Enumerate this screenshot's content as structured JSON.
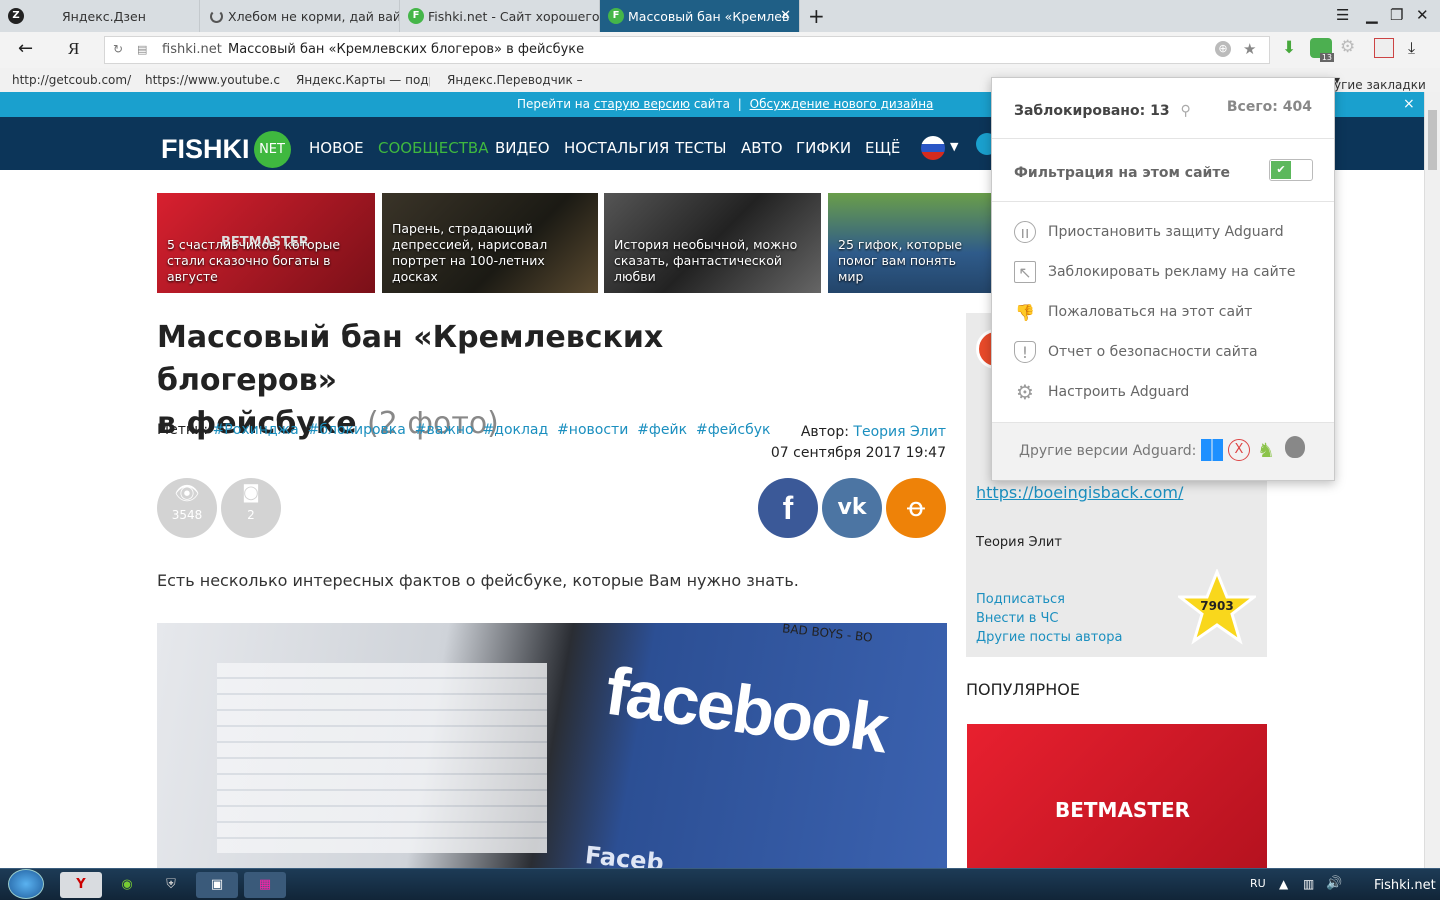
{
  "browser": {
    "tabs": [
      {
        "label": "Яндекс.Дзен",
        "icon": "Z"
      },
      {
        "label": "Хлебом не корми, дай вай",
        "icon": "spinner"
      },
      {
        "label": "Fishki.net - Сайт хорошего",
        "icon": "F"
      },
      {
        "label": "Массовый бан «Кремлев",
        "icon": "F"
      }
    ],
    "address": {
      "domain": "fishki.net",
      "title": "Массовый бан «Кремлевских блогеров» в фейсбуке",
      "yandex": "Я"
    },
    "bookmarks": [
      "http://getcoub.com/",
      "https://www.youtube.c",
      "Яндекс.Карты — подр",
      "Яндекс.Переводчик –",
      "угие закладки"
    ],
    "adguard_badge": "13"
  },
  "page": {
    "notice": {
      "prefix": "Перейти на",
      "link1": "старую версию",
      "middle": "сайта",
      "sep": "|",
      "link2": "Обсуждение нового дизайна",
      "close": "×"
    },
    "logo": {
      "main": "FISHKI",
      "badge": "NET"
    },
    "nav": [
      "НОВОЕ",
      "СООБЩЕСТВА",
      "ВИДЕО",
      "НОСТАЛЬГИЯ",
      "ТЕСТЫ",
      "АВТО",
      "ГИФКИ",
      "ЕЩЁ"
    ],
    "cards": [
      {
        "text": "5 счастливчиков, которые стали сказочно богаты в августе",
        "brand": "BETMASTER"
      },
      {
        "text": "Парень, страдающий депрессией, нарисовал портрет на 100-летних досках"
      },
      {
        "text": "История необычной, можно сказать, фантастической любви"
      },
      {
        "text": "25 гифок, которые помог вам понять мир"
      }
    ],
    "article": {
      "title_line1": "Массовый бан «Кремлевских блогеров»",
      "title_line2": "в фейсбуке",
      "title_count": "(2 фото)",
      "tags_label": "Метки:",
      "tags": [
        "#Рохинджа",
        "#блокировка",
        "#важно",
        "#доклад",
        "#новости",
        "#фейк",
        "#фейсбук"
      ],
      "author_label": "Автор:",
      "author": "Теория Элит",
      "date": "07 сентября 2017 19:47",
      "views": "3548",
      "photos": "2",
      "intro": "Есть несколько интересных фактов о фейсбуке, которые Вам нужно знать.",
      "image_words": [
        "facebook",
        "BAD BOYS - BO",
        "Faceb"
      ]
    },
    "sidebar": {
      "link": "https://boeingisback.com/",
      "author": "Теория Элит",
      "actions": [
        "Подписаться",
        "Внести в ЧС",
        "Другие посты автора"
      ],
      "rating": "7903",
      "popular": "ПОПУЛЯРНОЕ",
      "ad": "BETMASTER"
    }
  },
  "adguard": {
    "blocked_label": "Заблокировано:",
    "blocked": "13",
    "total_label": "Всего:",
    "total": "404",
    "filter_label": "Фильтрация на этом сайте",
    "filter_on": true,
    "menu": [
      "Приостановить защиту Adguard",
      "Заблокировать рекламу на сайте",
      "Пожаловаться на этот сайт",
      "Отчет о безопасности сайта",
      "Настроить Adguard"
    ],
    "other_versions": "Другие версии Adguard:"
  },
  "taskbar": {
    "lang": "RU",
    "corner": "Fishki.net"
  },
  "colors": {
    "nav": "#0c3559",
    "accent": "#1aa0ce",
    "green": "#3fb83f",
    "link": "#1b8fbf",
    "fb": "#3b5998",
    "vk": "#4c75a3",
    "ok": "#ee8208"
  }
}
